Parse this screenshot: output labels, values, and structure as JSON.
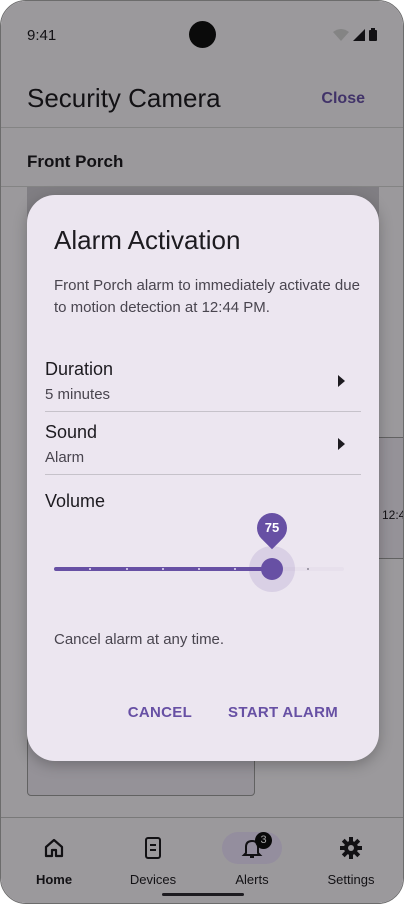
{
  "status": {
    "time": "9:41"
  },
  "appbar": {
    "title": "Security Camera",
    "close_label": "Close"
  },
  "subheader": {
    "label": "Front Porch"
  },
  "background": {
    "timestamp_fragment": "12:4"
  },
  "dialog": {
    "title": "Alarm Activation",
    "body": "Front Porch alarm to immediately activate due to motion detection at 12:44 PM.",
    "rows": [
      {
        "label": "Duration",
        "value": "5 minutes"
      },
      {
        "label": "Sound",
        "value": "Alarm"
      }
    ],
    "volume": {
      "label": "Volume",
      "value": 75,
      "value_label": "75",
      "max": 100,
      "steps": 8
    },
    "cancel_note": "Cancel alarm at any time.",
    "cancel_label": "CANCEL",
    "start_label": "START ALARM"
  },
  "nav": {
    "items": [
      {
        "label": "Home",
        "icon": "home-icon"
      },
      {
        "label": "Devices",
        "icon": "device-icon"
      },
      {
        "label": "Alerts",
        "icon": "bell-icon",
        "badge": "3",
        "active": true
      },
      {
        "label": "Settings",
        "icon": "gear-icon"
      }
    ]
  },
  "colors": {
    "accent": "#6750a4",
    "scrim": "rgba(0,0,0,0.36)",
    "dialog": "#ece6f0"
  }
}
